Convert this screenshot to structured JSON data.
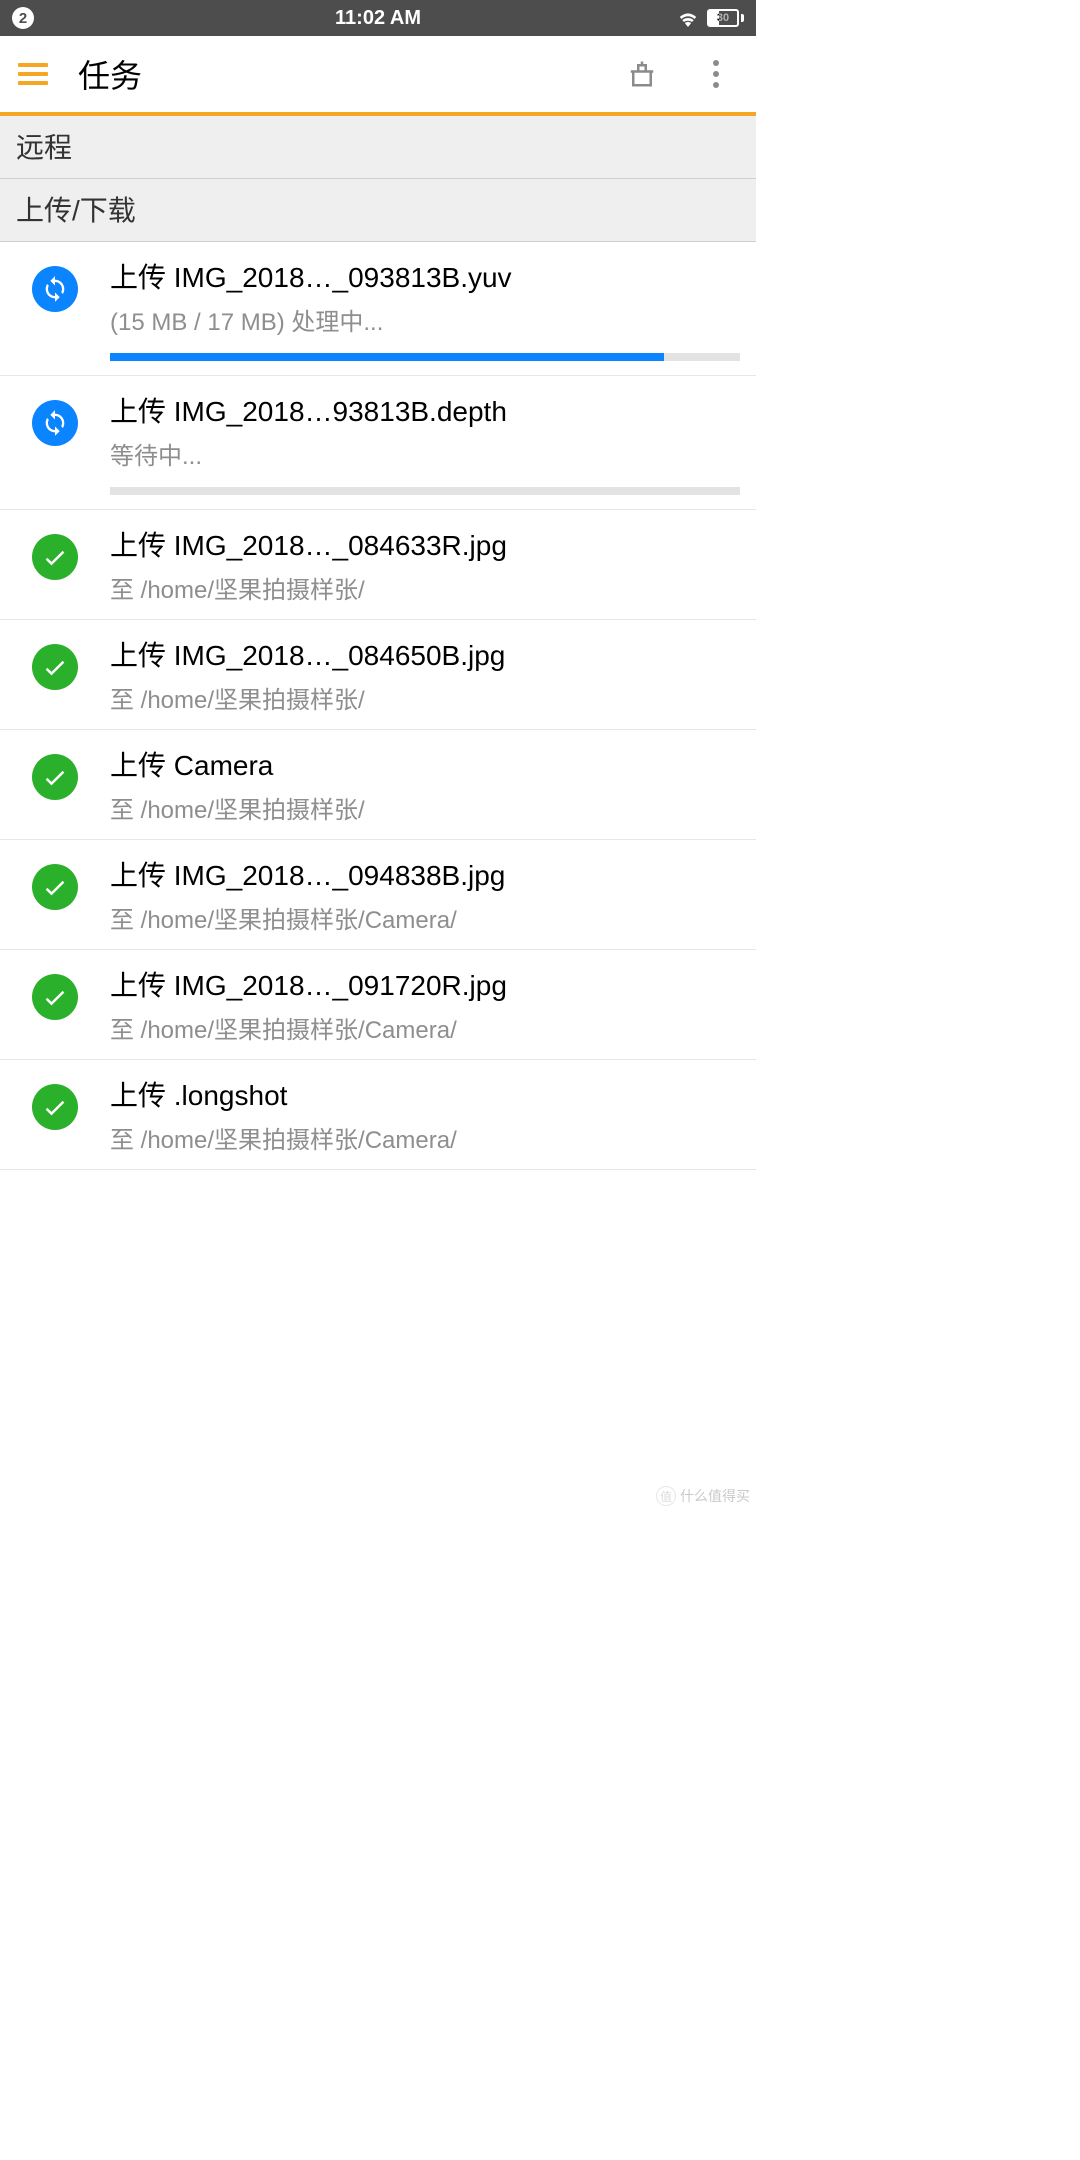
{
  "status_bar": {
    "notif_count": "2",
    "time": "11:02 AM",
    "battery": "30"
  },
  "toolbar": {
    "title": "任务"
  },
  "sections": {
    "remote": "远程",
    "transfer": "上传/下载"
  },
  "tasks": [
    {
      "status": "syncing",
      "title": "上传 IMG_2018…_093813B.yuv",
      "sub": "(15 MB / 17 MB) 处理中...",
      "progress": 88
    },
    {
      "status": "syncing",
      "title": "上传 IMG_2018…93813B.depth",
      "sub": "等待中...",
      "progress": 0
    },
    {
      "status": "done",
      "title": "上传 IMG_2018…_084633R.jpg",
      "sub": "至 /home/坚果拍摄样张/"
    },
    {
      "status": "done",
      "title": "上传 IMG_2018…_084650B.jpg",
      "sub": "至 /home/坚果拍摄样张/"
    },
    {
      "status": "done",
      "title": "上传 Camera",
      "sub": "至 /home/坚果拍摄样张/"
    },
    {
      "status": "done",
      "title": "上传 IMG_2018…_094838B.jpg",
      "sub": "至 /home/坚果拍摄样张/Camera/"
    },
    {
      "status": "done",
      "title": "上传 IMG_2018…_091720R.jpg",
      "sub": "至 /home/坚果拍摄样张/Camera/"
    },
    {
      "status": "done",
      "title": "上传 .longshot",
      "sub": "至 /home/坚果拍摄样张/Camera/"
    }
  ],
  "watermark": {
    "logo": "值",
    "text": "什么值得买"
  }
}
